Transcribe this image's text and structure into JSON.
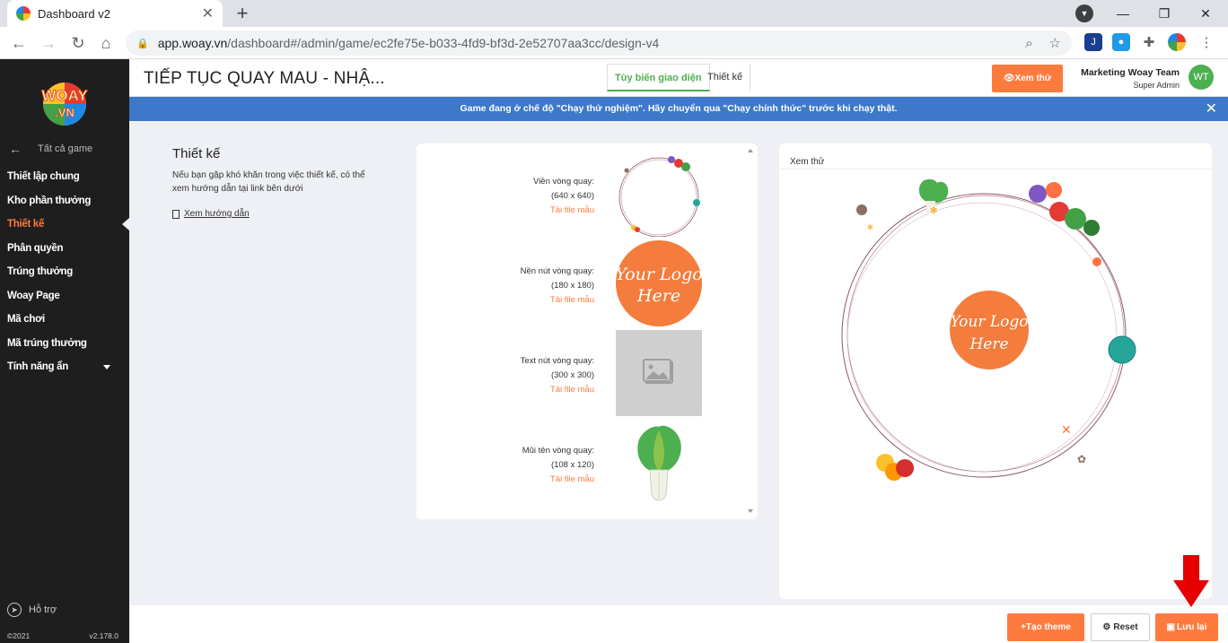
{
  "browser": {
    "tab_title": "Dashboard v2",
    "tab_close": "✕",
    "new_tab": "+",
    "url_host": "app.woay.vn",
    "url_path": "/dashboard#/admin/game/ec2fe75e-b033-4fd9-bf3d-2e52707aa3cc/design-v4"
  },
  "sidebar": {
    "logo_top": "WOAY",
    "logo_bottom": ".VN",
    "back_label": "Tất cả game",
    "items": [
      {
        "label": "Thiết lập chung"
      },
      {
        "label": "Kho phần thưởng"
      },
      {
        "label": "Thiết kế"
      },
      {
        "label": "Phân quyền"
      },
      {
        "label": "Trúng thưởng"
      },
      {
        "label": "Woay Page"
      },
      {
        "label": "Mã chơi"
      },
      {
        "label": "Mã trúng thưởng"
      },
      {
        "label": "Tính năng ẩn"
      }
    ],
    "support": "Hỗ trợ",
    "copyright": "©2021",
    "version": "v2.178.0"
  },
  "header": {
    "game_title": "TIẾP TỤC QUAY MAU - NHẬ...",
    "tab_customize": "Tùy biến giao diện",
    "tab_design": "Thiết kế",
    "preview_button": "Xem thử",
    "user_name": "Marketing Woay Team",
    "user_role": "Super Admin",
    "avatar_initials": "WT"
  },
  "banner": {
    "text": "Game đang ở chế độ \"Chạy thử nghiệm\". Hãy chuyển qua \"Chạy chính thức\" trước khi chạy thật.",
    "close": "✕"
  },
  "design": {
    "title": "Thiết kế",
    "description": "Nếu bạn gặp khó khăn trong việc thiết kế, có thể xem hướng dẫn tại link bên dưới",
    "guide_link": "Xem hướng dẫn",
    "assets": [
      {
        "label": "Viền vòng quay:",
        "size": "(640 x 640)",
        "download": "Tải file mẫu"
      },
      {
        "label": "Nền nút vòng quay:",
        "size": "(180 x 180)",
        "download": "Tải file mẫu"
      },
      {
        "label": "Text nút vòng quay:",
        "size": "(300 x 300)",
        "download": "Tải file mẫu"
      },
      {
        "label": "Mũi tên vòng quay:",
        "size": "(108 x 120)",
        "download": "Tải file mẫu"
      }
    ],
    "logo_text_line1": "Your Logo",
    "logo_text_line2": "Here"
  },
  "preview": {
    "label": "Xem thử"
  },
  "footer": {
    "create_theme": "Tạo theme",
    "reset": "Reset",
    "save": "Lưu lại"
  },
  "colors": {
    "accent": "#ff7a3d",
    "banner": "#3d78c9",
    "sidebar": "#1e1e1e",
    "active_tab": "#4caf50"
  }
}
